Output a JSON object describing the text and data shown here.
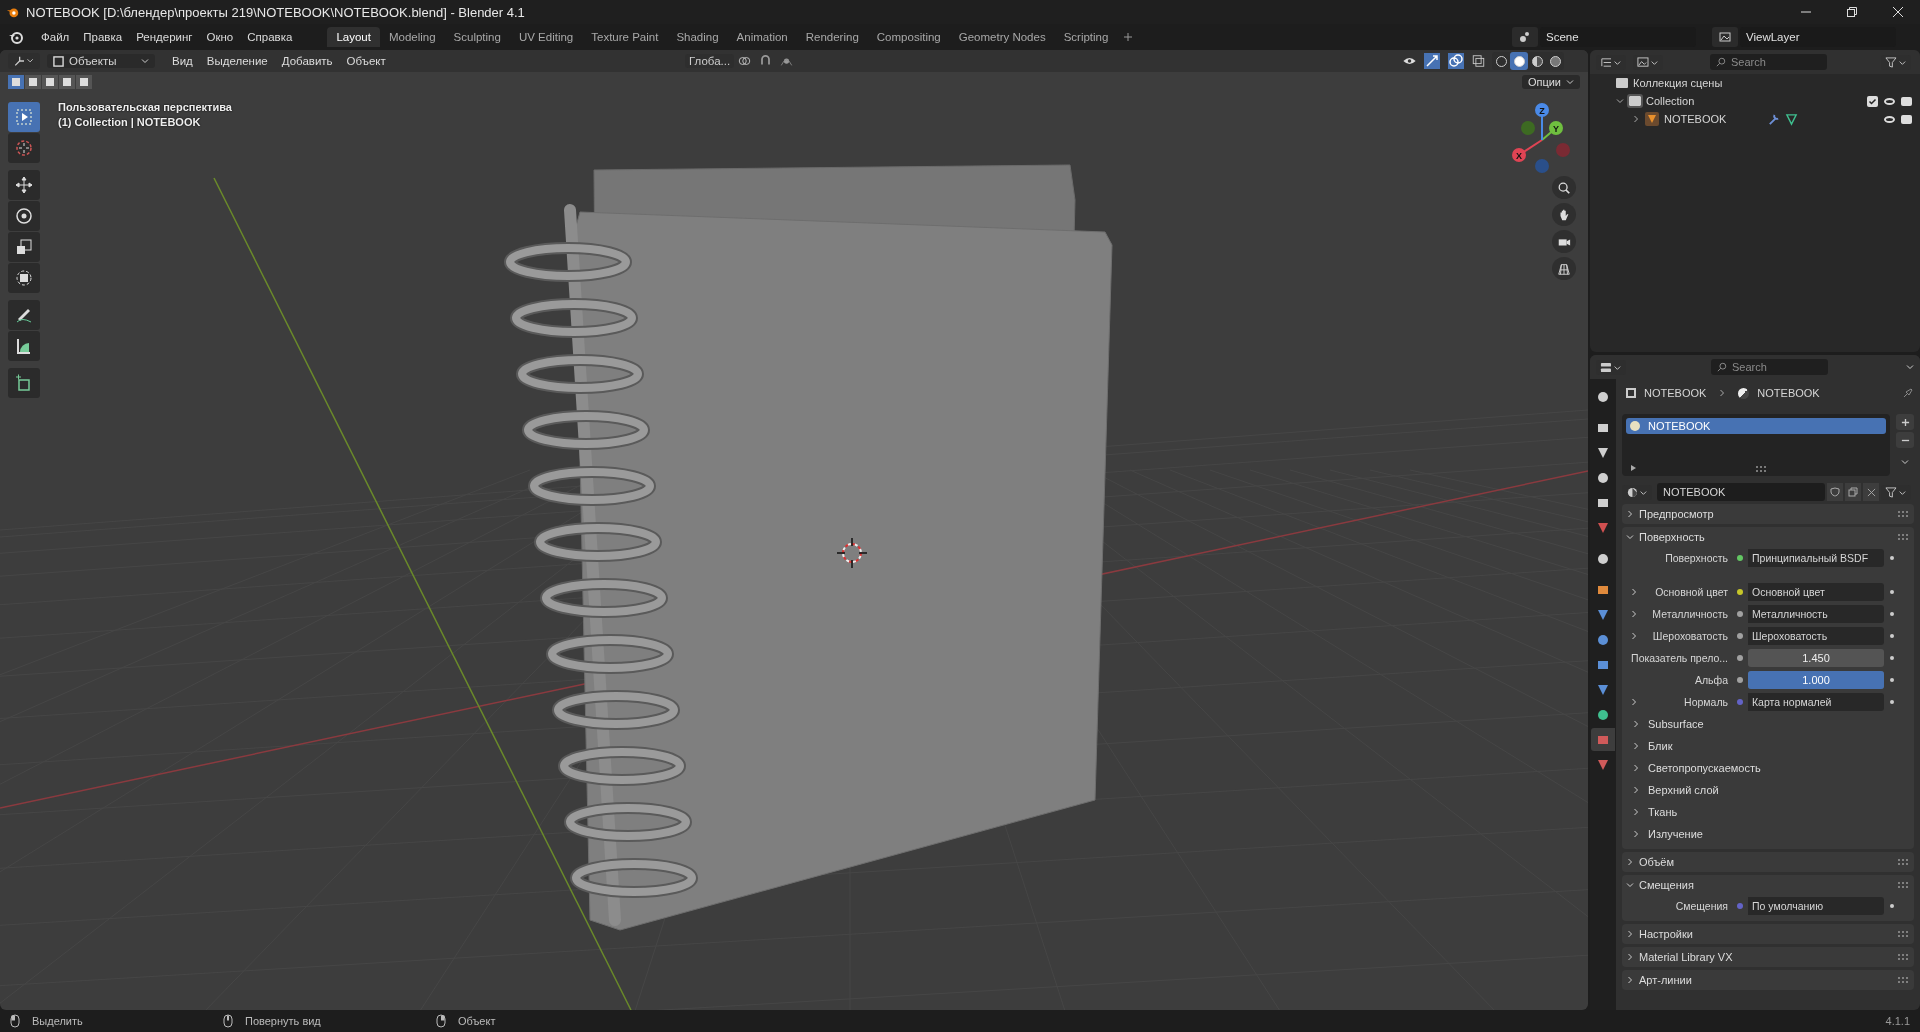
{
  "window": {
    "title": "NOTEBOOK [D:\\блендер\\проекты 219\\NOTEBOOK\\NOTEBOOK.blend] - Blender 4.1"
  },
  "menu": [
    "Файл",
    "Правка",
    "Рендеринг",
    "Окно",
    "Справка"
  ],
  "workspaces": [
    {
      "label": "Layout",
      "selected": true
    },
    {
      "label": "Modeling",
      "selected": false
    },
    {
      "label": "Sculpting",
      "selected": false
    },
    {
      "label": "UV Editing",
      "selected": false
    },
    {
      "label": "Texture Paint",
      "selected": false
    },
    {
      "label": "Shading",
      "selected": false
    },
    {
      "label": "Animation",
      "selected": false
    },
    {
      "label": "Rendering",
      "selected": false
    },
    {
      "label": "Compositing",
      "selected": false
    },
    {
      "label": "Geometry Nodes",
      "selected": false
    },
    {
      "label": "Scripting",
      "selected": false
    }
  ],
  "scene": "Scene",
  "view_layer": "ViewLayer",
  "viewport": {
    "mode": "Объекты",
    "menus": [
      "Вид",
      "Выделение",
      "Добавить",
      "Объект"
    ],
    "orientation": "Глоба...",
    "options": "Опции",
    "select_modes": [
      {
        "selected": true
      },
      {
        "selected": false
      },
      {
        "selected": false
      },
      {
        "selected": false
      },
      {
        "selected": false
      }
    ],
    "shading": [
      {
        "selected": false
      },
      {
        "selected": true
      },
      {
        "selected": false
      },
      {
        "selected": false
      }
    ],
    "overlay_title": "Пользовательская перспектива",
    "overlay_object": "(1) Collection | NOTEBOOK",
    "tools": [
      {
        "selected": true
      },
      {
        "selected": false
      },
      {
        "selected": false
      },
      {
        "selected": false
      },
      {
        "selected": false
      },
      {
        "selected": false
      },
      {
        "selected": false
      },
      {
        "selected": false
      },
      {
        "selected": false
      }
    ],
    "gizmo_axes": [
      "X",
      "Y",
      "Z"
    ]
  },
  "outliner": {
    "search_placeholder": "Search",
    "root": "Коллекция сцены",
    "collections": [
      {
        "label": "Collection",
        "expanded": true,
        "checked": true,
        "children": [
          {
            "label": "NOTEBOOK",
            "expanded": false
          }
        ]
      }
    ]
  },
  "properties": {
    "search_placeholder": "Search",
    "breadcrumb": [
      "NOTEBOOK",
      "NOTEBOOK"
    ],
    "tabs": [
      {
        "selected": false
      },
      {
        "selected": false
      },
      {
        "selected": false
      },
      {
        "selected": false
      },
      {
        "selected": false
      },
      {
        "selected": false
      },
      {
        "selected": false
      },
      {
        "selected": false
      },
      {
        "selected": false
      },
      {
        "selected": false
      },
      {
        "selected": false
      },
      {
        "selected": false
      },
      {
        "selected": false
      },
      {
        "selected": true
      },
      {
        "selected": false
      }
    ],
    "slots": [
      {
        "label": "NOTEBOOK",
        "selected": true
      }
    ],
    "material_name": "NOTEBOOK",
    "panels": [
      {
        "title": "Предпросмотр",
        "expanded": false
      },
      {
        "title": "Поверхность",
        "expanded": true,
        "rows": [
          {
            "kind": "socket",
            "label": "Поверхность",
            "value": "Принципиальный BSDF",
            "color": "#63c763",
            "expandable": false
          },
          {
            "kind": "gap"
          },
          {
            "kind": "socket",
            "label": "Основной цвет",
            "value": "Основной цвет",
            "color": "#c7c729",
            "expandable": true
          },
          {
            "kind": "socket",
            "label": "Металличность",
            "value": "Металличность",
            "color": "#a1a1a1",
            "expandable": true
          },
          {
            "kind": "socket",
            "label": "Шероховатость",
            "value": "Шероховатость",
            "color": "#a1a1a1",
            "expandable": true
          },
          {
            "kind": "number",
            "label": "Показатель прело...",
            "value": "1.450",
            "color": "#a1a1a1",
            "expandable": false
          },
          {
            "kind": "slider",
            "label": "Альфа",
            "value": "1.000",
            "color": "#a1a1a1",
            "level": 1,
            "expandable": false
          },
          {
            "kind": "socket",
            "label": "Нормаль",
            "value": "Карта нормалей",
            "color": "#6363c7",
            "expandable": true
          },
          {
            "kind": "sub",
            "label": "Subsurface"
          },
          {
            "kind": "sub",
            "label": "Блик"
          },
          {
            "kind": "sub",
            "label": "Светопропускаемость"
          },
          {
            "kind": "sub",
            "label": "Верхний слой"
          },
          {
            "kind": "sub",
            "label": "Ткань"
          },
          {
            "kind": "sub",
            "label": "Излучение"
          }
        ]
      },
      {
        "title": "Объём",
        "expanded": false
      },
      {
        "title": "Смещения",
        "expanded": true,
        "rows": [
          {
            "kind": "socket",
            "label": "Смещения",
            "value": "По умолчанию",
            "color": "#6363c7",
            "expandable": false
          }
        ]
      },
      {
        "title": "Настройки",
        "expanded": false
      },
      {
        "title": "Material Library VX",
        "expanded": false
      },
      {
        "title": "Арт-линии",
        "expanded": false
      }
    ]
  },
  "status_bar": {
    "hints": [
      "Выделить",
      "Повернуть вид",
      "Объект"
    ],
    "version": "4.1.1"
  }
}
